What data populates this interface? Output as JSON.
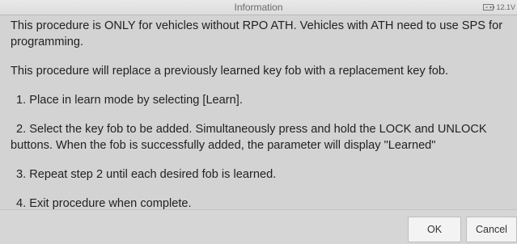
{
  "window": {
    "title": "Information",
    "status": {
      "battery_icon": "battery-icon",
      "voltage": "12.1V"
    }
  },
  "message": {
    "paragraphs": [
      "This procedure is ONLY for vehicles without RPO ATH. Vehicles with ATH need to use SPS for programming.",
      "This procedure will replace a previously learned key fob with a replacement key fob.",
      "1. Place in learn mode by selecting [Learn].",
      "2. Select the key fob to be added. Simultaneously press and hold the LOCK and UNLOCK buttons. When the fob is successfully added, the parameter will display \"Learned\"",
      "3. Repeat step 2 until each desired fob is learned.",
      "4. Exit procedure when complete."
    ]
  },
  "buttons": {
    "ok": "OK",
    "cancel": "Cancel"
  }
}
